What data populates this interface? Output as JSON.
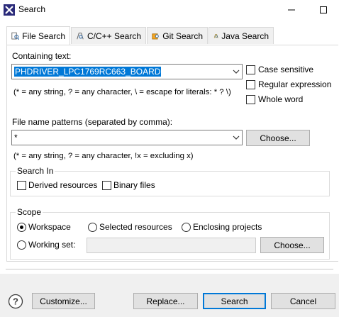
{
  "window": {
    "title": "Search",
    "icon": "eclipse-x-icon",
    "minimize_icon": "minimize-icon",
    "maximize_icon": "maximize-icon"
  },
  "tabs": [
    {
      "label": "File Search",
      "icon": "file-search-icon",
      "active": true
    },
    {
      "label": "C/C++ Search",
      "icon": "c-search-icon",
      "active": false
    },
    {
      "label": "Git Search",
      "icon": "git-search-icon",
      "active": false
    },
    {
      "label": "Java Search",
      "icon": "java-search-icon",
      "active": false
    }
  ],
  "containing_text": {
    "label": "Containing text:",
    "value": "PHDRIVER_LPC1769RC663_BOARD",
    "hint": "(* = any string, ? = any character, \\ = escape for literals: * ? \\)",
    "options": [
      {
        "label": "Case sensitive",
        "checked": false
      },
      {
        "label": "Regular expression",
        "checked": false
      },
      {
        "label": "Whole word",
        "checked": false
      }
    ]
  },
  "file_patterns": {
    "label": "File name patterns (separated by comma):",
    "value": "*",
    "choose_label": "Choose...",
    "hint": "(* = any string, ? = any character, !x = excluding x)"
  },
  "search_in": {
    "title": "Search In",
    "options": [
      {
        "label": "Derived resources",
        "checked": false
      },
      {
        "label": "Binary files",
        "checked": false
      }
    ]
  },
  "scope": {
    "title": "Scope",
    "workspace": "Workspace",
    "selected_resources": "Selected resources",
    "enclosing_projects": "Enclosing projects",
    "working_set": "Working set:",
    "working_set_value": "",
    "choose_label": "Choose...",
    "selected": "Workspace"
  },
  "footer": {
    "help_icon": "help-icon",
    "customize_label": "Customize...",
    "replace_label": "Replace...",
    "search_label": "Search",
    "cancel_label": "Cancel"
  },
  "colors": {
    "selection": "#0078d7",
    "panel_bg": "#ffffff",
    "footer_bg": "#f0f0f0"
  }
}
